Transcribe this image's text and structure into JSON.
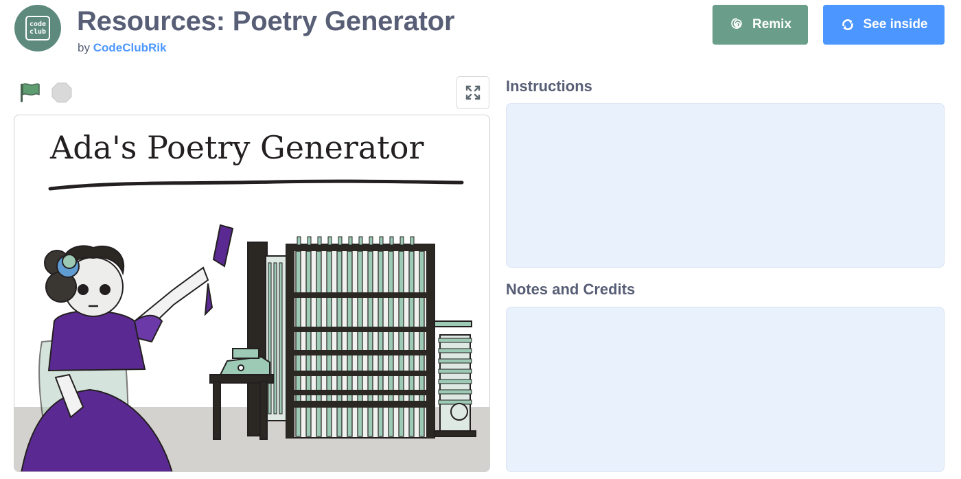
{
  "header": {
    "avatar_text_line1": "code",
    "avatar_text_line2": "club",
    "title": "Resources: Poetry Generator",
    "by_prefix": "by",
    "author": "CodeClubRik"
  },
  "buttons": {
    "remix_label": "Remix",
    "remix_icon": "remix-swirl-icon",
    "see_inside_label": "See inside",
    "see_inside_icon": "see-inside-arrows-icon"
  },
  "player": {
    "green_flag_icon": "green-flag-icon",
    "stop_icon": "stop-icon",
    "fullscreen_icon": "fullscreen-icon",
    "stage_title": "Ada's Poetry Generator"
  },
  "sections": {
    "instructions_heading": "Instructions",
    "instructions_body": "",
    "notes_heading": "Notes and Credits",
    "notes_body": ""
  },
  "colors": {
    "text": "#575e75",
    "link": "#4c97ff",
    "remix_button": "#6a9e8a",
    "see_inside_button": "#4c97ff",
    "panel_background": "#e9f1fc"
  }
}
